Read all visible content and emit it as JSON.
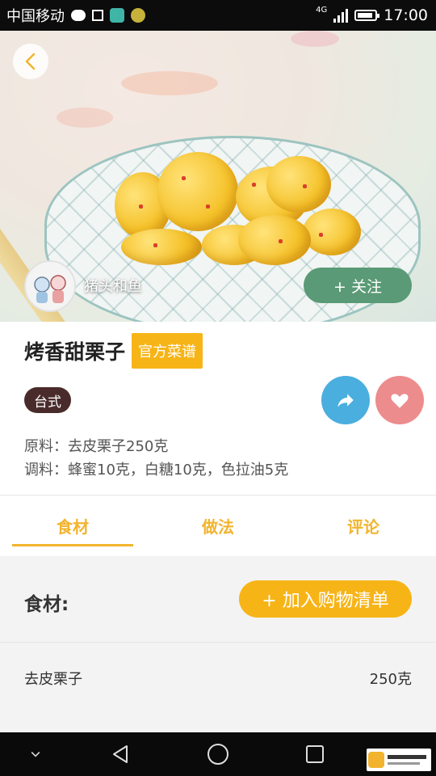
{
  "status_bar": {
    "carrier": "中国移动",
    "network": "4G",
    "time": "17:00"
  },
  "author": {
    "name": "猪头和鱼",
    "follow_label": "+ 关注"
  },
  "recipe": {
    "title": "烤香甜栗子",
    "badge": "官方菜谱",
    "tag": "台式",
    "main_ingredients": "原料：去皮栗子250克",
    "seasonings": "调料：蜂蜜10克，白糖10克，色拉油5克"
  },
  "tabs": [
    {
      "label": "食材",
      "active": true
    },
    {
      "label": "做法",
      "active": false
    },
    {
      "label": "评论",
      "active": false
    }
  ],
  "ingredients": {
    "header": "食材:",
    "add_button": "+ 加入购物清单",
    "items": [
      {
        "name": "去皮栗子",
        "amount": "250克"
      }
    ]
  },
  "colors": {
    "accent": "#f7b417",
    "follow": "#5a9a76",
    "share": "#4aaede",
    "favorite": "#ec8c8c",
    "tag": "#4a2b2b"
  }
}
